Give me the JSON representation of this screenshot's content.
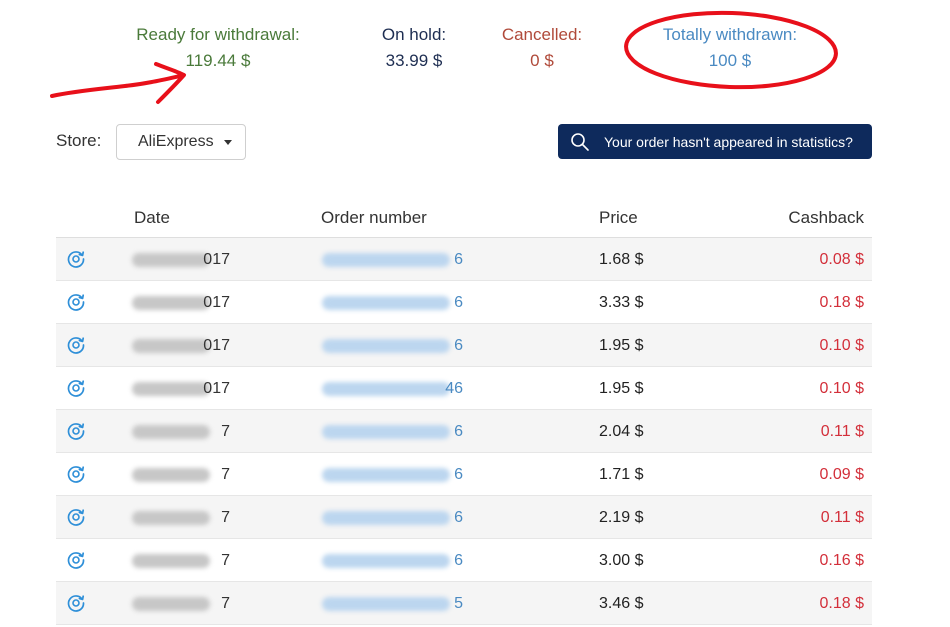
{
  "stats": {
    "ready": {
      "label": "Ready for withdrawal:",
      "value": "119.44 $"
    },
    "hold": {
      "label": "On hold:",
      "value": "33.99 $"
    },
    "cancelled": {
      "label": "Cancelled:",
      "value": "0 $"
    },
    "withdrawn": {
      "label": "Totally withdrawn:",
      "value": "100 $"
    }
  },
  "filters": {
    "store_label": "Store:",
    "store_value": "AliExpress",
    "missing_button": "Your order hasn't appeared in statistics?"
  },
  "table": {
    "headers": {
      "date": "Date",
      "order": "Order number",
      "price": "Price",
      "cashback": "Cashback"
    },
    "rows": [
      {
        "date": "017",
        "order": "6",
        "price": "1.68 $",
        "cashback": "0.08 $"
      },
      {
        "date": "017",
        "order": "6",
        "price": "3.33 $",
        "cashback": "0.18 $"
      },
      {
        "date": "017",
        "order": "6",
        "price": "1.95 $",
        "cashback": "0.10 $"
      },
      {
        "date": "017",
        "order": "46",
        "price": "1.95 $",
        "cashback": "0.10 $"
      },
      {
        "date": "7",
        "order": "6",
        "price": "2.04 $",
        "cashback": "0.11 $"
      },
      {
        "date": "7",
        "order": "6",
        "price": "1.71 $",
        "cashback": "0.09 $"
      },
      {
        "date": "7",
        "order": "6",
        "price": "2.19 $",
        "cashback": "0.11 $"
      },
      {
        "date": "7",
        "order": "6",
        "price": "3.00 $",
        "cashback": "0.16 $"
      },
      {
        "date": "7",
        "order": "5",
        "price": "3.46 $",
        "cashback": "0.18 $"
      }
    ]
  },
  "colors": {
    "ready": "#4a7a3a",
    "hold": "#1e2e52",
    "cancelled": "#b04a3a",
    "withdrawn": "#4a8ac2",
    "button": "#0e2a5c",
    "cashback": "#d32f3a",
    "annotation": "#e8101a"
  },
  "icons": {
    "row_action": "refresh-circle-icon",
    "search": "search-icon",
    "dropdown": "caret-down-icon"
  }
}
